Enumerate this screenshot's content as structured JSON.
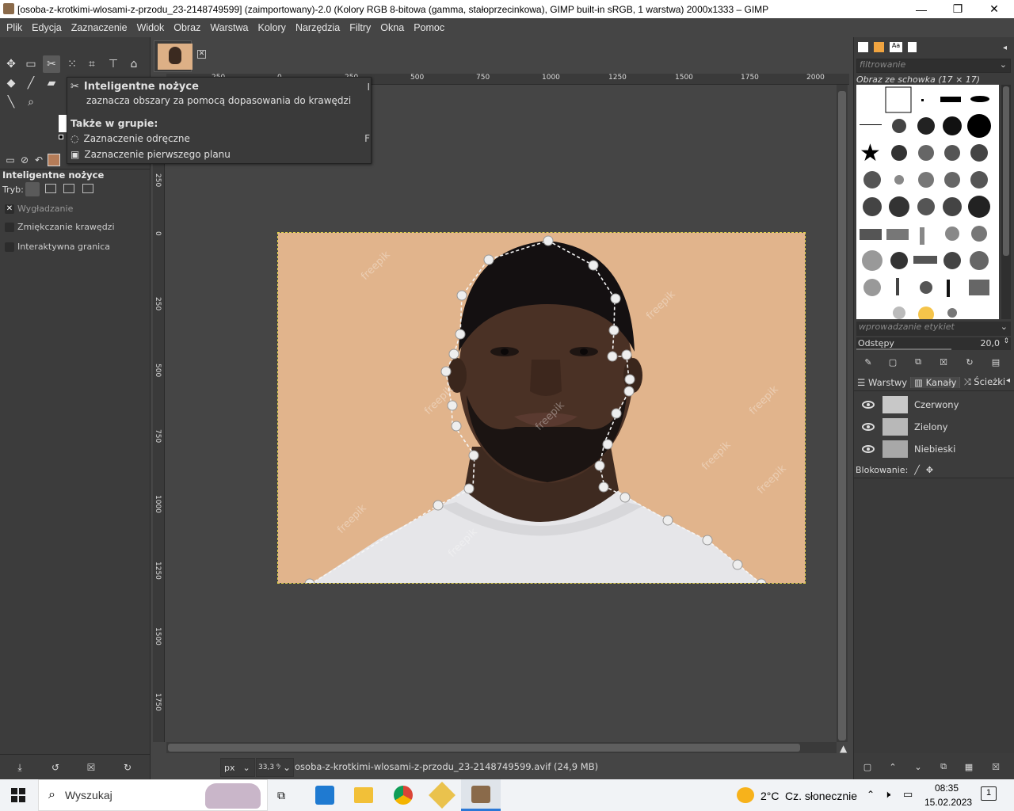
{
  "window": {
    "title": "[osoba-z-krotkimi-wlosami-z-przodu_23-2148749599] (zaimportowany)-2.0 (Kolory RGB 8-bitowa (gamma, stałoprzecinkowa), GIMP built-in sRGB, 1 warstwa) 2000x1333 – GIMP",
    "minimize": "—",
    "maximize": "❐",
    "close": "✕"
  },
  "menu": [
    "Plik",
    "Edycja",
    "Zaznaczenie",
    "Widok",
    "Obraz",
    "Warstwa",
    "Kolory",
    "Narzędzia",
    "Filtry",
    "Okna",
    "Pomoc"
  ],
  "tooltip": {
    "title": "Inteligentne nożyce",
    "title_key": "I",
    "description": "zaznacza obszary za pomocą dopasowania do krawędzi",
    "group_heading": "Także w grupie:",
    "group_items": [
      {
        "label": "Zaznaczenie odręczne",
        "key": "F"
      },
      {
        "label": "Zaznaczenie pierwszego planu",
        "key": ""
      }
    ]
  },
  "tool_options": {
    "title": "Inteligentne nożyce",
    "mode_label": "Tryb:",
    "options": [
      {
        "label": "Wygładzanie",
        "checked": true
      },
      {
        "label": "Zmiękczanie krawędzi",
        "checked": false
      },
      {
        "label": "Interaktywna granica",
        "checked": false
      }
    ]
  },
  "ruler": {
    "h_labels": [
      "250",
      "0",
      "250",
      "500",
      "750",
      "1000",
      "1250",
      "1500",
      "1750",
      "2000"
    ],
    "v_labels": [
      "250",
      "0",
      "250",
      "500",
      "750",
      "1000",
      "1250",
      "1500",
      "1750"
    ]
  },
  "statusbar": {
    "unit": "px",
    "zoom": "33,3 %",
    "filename": "osoba-z-krotkimi-wlosami-z-przodu_23-2148749599.avif (24,9 MB)"
  },
  "brushes": {
    "filter_placeholder": "filtrowanie",
    "clipboard_label": "Obraz ze schowka (17 × 17)",
    "tags_placeholder": "wprowadzanie etykiet",
    "spacing_label": "Odstępy",
    "spacing_value": "20,0"
  },
  "channels": {
    "tabs": [
      "Warstwy",
      "Kanały",
      "Ścieżki"
    ],
    "items": [
      "Czerwony",
      "Zielony",
      "Niebieski"
    ],
    "lock_label": "Blokowanie:"
  },
  "taskbar": {
    "search": "Wyszukaj",
    "weather_temp": "2°C",
    "weather_text": "Cz. słonecznie",
    "time": "08:35",
    "date": "15.02.2023",
    "notif_count": "1"
  },
  "image_watermark": "freepik"
}
